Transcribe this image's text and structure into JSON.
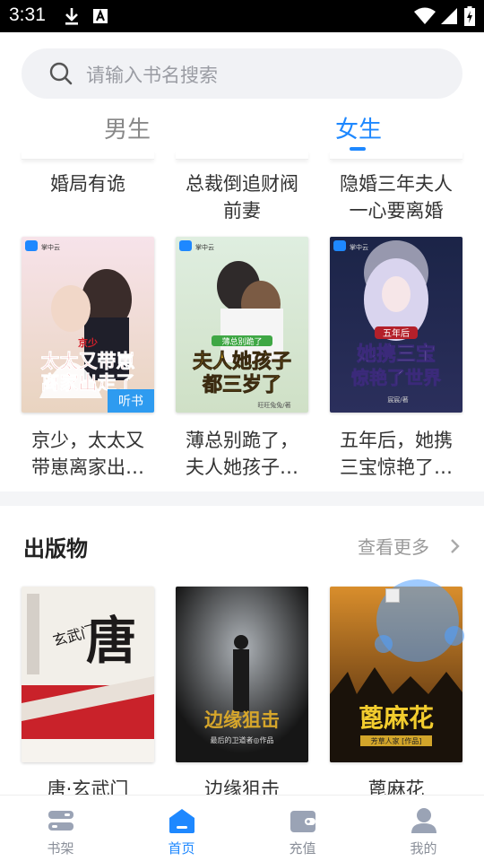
{
  "status_bar": {
    "time": "3:31"
  },
  "search": {
    "placeholder": "请输入书名搜索"
  },
  "gender_tabs": [
    {
      "label": "男生",
      "active": false
    },
    {
      "label": "女生",
      "active": true
    }
  ],
  "top_row_titles": [
    {
      "line1": "婚局有诡",
      "line2": ""
    },
    {
      "line1": "总裁倒追财阀",
      "line2": "前妻"
    },
    {
      "line1": "隐婚三年夫人",
      "line2": "一心要离婚"
    }
  ],
  "books": [
    {
      "title_line1": "京少，太太又",
      "title_line2": "带崽离家出…",
      "cover_publisher": "掌中云",
      "cover_text": [
        "京少",
        "太太又带崽",
        "离家出走了"
      ],
      "cover_badge": "听书"
    },
    {
      "title_line1": "薄总别跪了，",
      "title_line2": "夫人她孩子…",
      "cover_publisher": "掌中云",
      "cover_text": [
        "薄总别跪了",
        "夫人她孩子",
        "都三岁了"
      ],
      "cover_author": "旺旺兔兔/著"
    },
    {
      "title_line1": "五年后，她携",
      "title_line2": "三宝惊艳了…",
      "cover_publisher": "掌中云",
      "cover_text": [
        "五年后",
        "她携三宝",
        "惊艳了世界"
      ],
      "cover_author": "宸宸/著"
    }
  ],
  "publications": {
    "section_title": "出版物",
    "see_more": "查看更多",
    "items": [
      {
        "title": "唐·玄武门",
        "cover_text": [
          "唐",
          "玄武门"
        ]
      },
      {
        "title": "边缘狙击",
        "cover_text": [
          "边缘狙击",
          "最后的卫道者◎作品"
        ]
      },
      {
        "title": "蓖麻花",
        "cover_text": [
          "蓖麻花",
          "芳草人家 [作品]"
        ]
      }
    ]
  },
  "bottom_nav": [
    {
      "label": "书架",
      "icon": "bookshelf-icon",
      "active": false
    },
    {
      "label": "首页",
      "icon": "home-icon",
      "active": true
    },
    {
      "label": "充值",
      "icon": "wallet-icon",
      "active": false
    },
    {
      "label": "我的",
      "icon": "user-icon",
      "active": false
    }
  ],
  "colors": {
    "accent": "#1e88ff",
    "text": "#333333",
    "muted": "#999999"
  }
}
